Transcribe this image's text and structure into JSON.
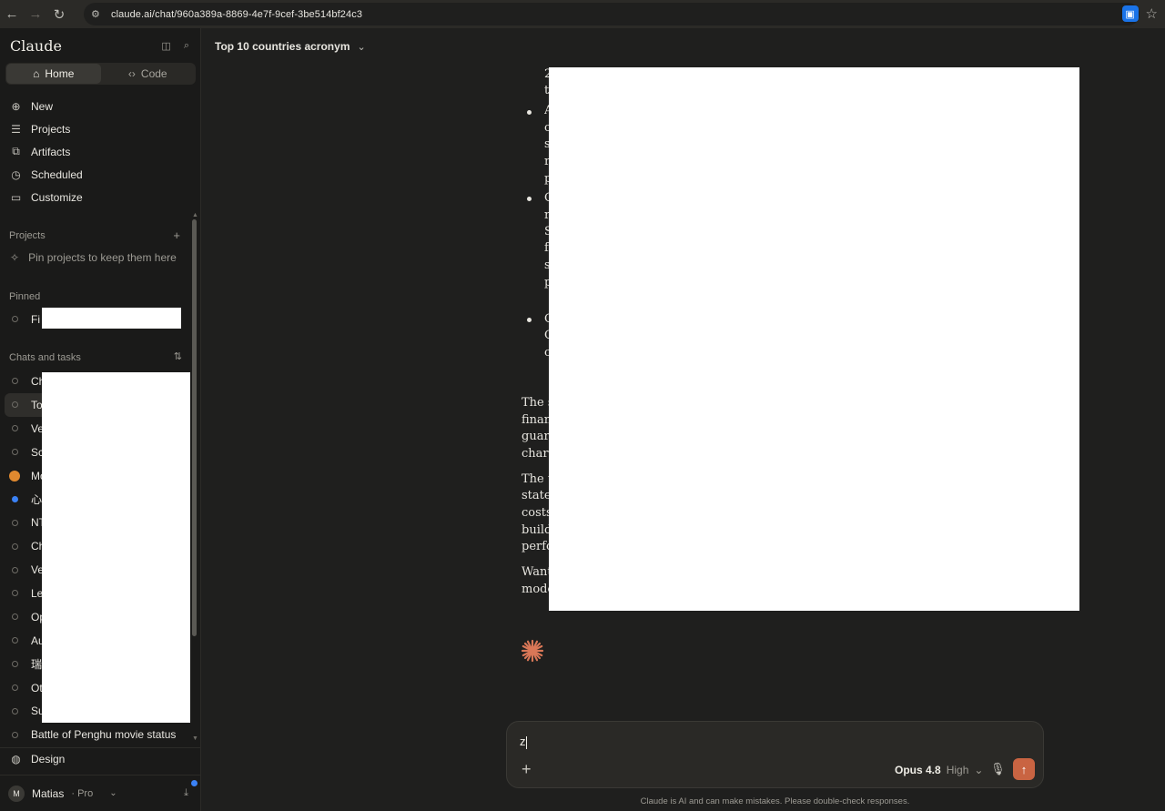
{
  "browser": {
    "url": "claude.ai/chat/960a389a-8869-4e7f-9cef-3be514bf24c3"
  },
  "sidebar": {
    "brand": "Claude",
    "mode_toggle": [
      {
        "label": "Home",
        "icon": "home-icon",
        "active": true
      },
      {
        "label": "Code",
        "icon": "code-icon",
        "active": false
      }
    ],
    "menu": [
      {
        "label": "New",
        "icon": "plus-circle-icon"
      },
      {
        "label": "Projects",
        "icon": "folder-icon"
      },
      {
        "label": "Artifacts",
        "icon": "artifacts-icon"
      },
      {
        "label": "Scheduled",
        "icon": "clock-icon"
      },
      {
        "label": "Customize",
        "icon": "briefcase-icon"
      }
    ],
    "projects_label": "Projects",
    "pin_hint": "Pin projects to keep them here",
    "pinned_label": "Pinned",
    "pinned_items": [
      "Fi"
    ],
    "chats_label": "Chats and tasks",
    "chats": [
      {
        "label": "Ch",
        "marker": "dot"
      },
      {
        "label": "To",
        "marker": "dot",
        "active": true
      },
      {
        "label": "Ve",
        "marker": "dot"
      },
      {
        "label": "Sc",
        "marker": "dot"
      },
      {
        "label": "Mo",
        "marker": "hand"
      },
      {
        "label": "心",
        "marker": "blue"
      },
      {
        "label": "NT",
        "marker": "dot"
      },
      {
        "label": "Ch",
        "marker": "dot"
      },
      {
        "label": "Ve",
        "marker": "dot"
      },
      {
        "label": "Le",
        "marker": "dot"
      },
      {
        "label": "Op",
        "marker": "dot"
      },
      {
        "label": "Au",
        "marker": "dot"
      },
      {
        "label": "瑞",
        "marker": "dot"
      },
      {
        "label": "Ot",
        "marker": "dot"
      },
      {
        "label": "Su",
        "marker": "dot"
      },
      {
        "label": "Battle of Penghu movie status",
        "marker": "dot"
      }
    ],
    "design_label": "Design",
    "user": {
      "initial": "M",
      "name": "Matias",
      "plan": "· Pro"
    }
  },
  "main": {
    "chat_title": "Top 10 countries acronym",
    "fragments": {
      "f1": "2",
      "f2": "t",
      "f3": "A",
      "f4": "c",
      "f5": "s",
      "f6": "r",
      "f7": "p",
      "f8": "C",
      "f9": "r",
      "f10": "S",
      "f11": "f",
      "f12": "s",
      "f13": "p",
      "f14": "C",
      "f15": "C",
      "f16": "c",
      "p1a": "The s",
      "p1b": "finan",
      "p1c": "guara",
      "p1d": "chart",
      "p2a": "The t",
      "p2b": "state",
      "p2c": "costs",
      "p2d": "build",
      "p2e": "perfo",
      "p3a": "Want",
      "p3b": "mode"
    }
  },
  "composer": {
    "input_value": "z",
    "model": "Opus 4.8",
    "effort": "High",
    "disclaimer": "Claude is AI and can make mistakes. Please double-check responses."
  },
  "colors": {
    "accent": "#c96442",
    "background": "#1f1f1e",
    "sidebar": "#1a1a19"
  }
}
